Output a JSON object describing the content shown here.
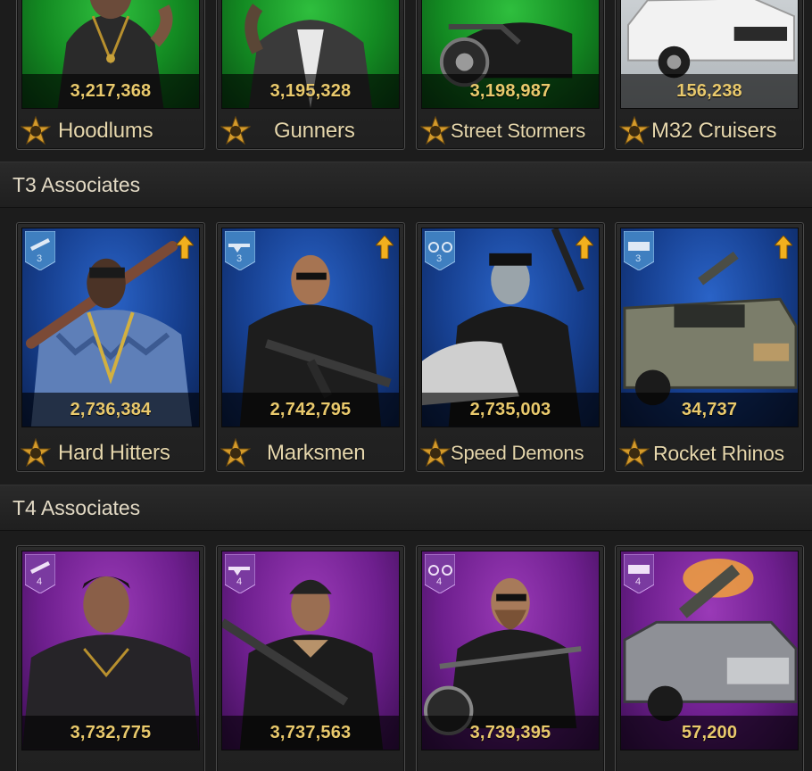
{
  "colors": {
    "count_text": "#e9c96c",
    "name_text": "#e6d7ad",
    "header_text": "#e2d9c4",
    "t2_bg": "#138a22",
    "t3_bg": "#163f8f",
    "t4_bg": "#6e1f8e"
  },
  "tier2": {
    "units": [
      {
        "count": "3,217,368",
        "name": "Hoodlums",
        "icon": "star-badge-icon"
      },
      {
        "count": "3,195,328",
        "name": "Gunners",
        "icon": "star-badge-icon"
      },
      {
        "count": "3,198,987",
        "name": "Street Stormers",
        "icon": "star-badge-icon"
      },
      {
        "count": "156,238",
        "name": "M32 Cruisers",
        "icon": "star-badge-icon"
      }
    ]
  },
  "tier3": {
    "title": "T3 Associates",
    "units": [
      {
        "count": "2,736,384",
        "name": "Hard Hitters",
        "tier": "3",
        "icon": "melee-weapon-icon"
      },
      {
        "count": "2,742,795",
        "name": "Marksmen",
        "tier": "3",
        "icon": "rifle-icon"
      },
      {
        "count": "2,735,003",
        "name": "Speed Demons",
        "tier": "3",
        "icon": "motorcycle-icon"
      },
      {
        "count": "34,737",
        "name": "Rocket Rhinos",
        "tier": "3",
        "icon": "vehicle-icon"
      }
    ]
  },
  "tier4": {
    "title": "T4 Associates",
    "units": [
      {
        "count": "3,732,775",
        "tier": "4",
        "icon": "melee-weapon-icon"
      },
      {
        "count": "3,737,563",
        "tier": "4",
        "icon": "rifle-icon"
      },
      {
        "count": "3,739,395",
        "tier": "4",
        "icon": "motorcycle-icon"
      },
      {
        "count": "57,200",
        "tier": "4",
        "icon": "vehicle-icon"
      }
    ]
  }
}
